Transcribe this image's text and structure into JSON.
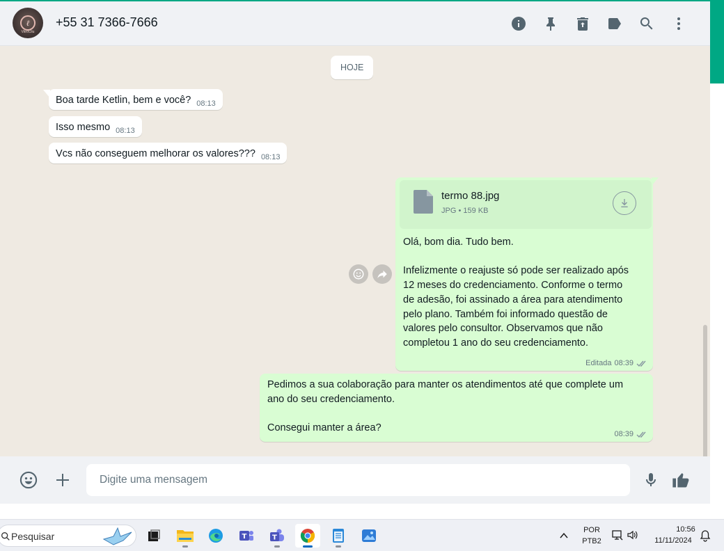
{
  "header": {
    "contact_name": "+55 31 7366-7666",
    "avatar_brand": "VitroCliu",
    "icons": [
      "info-icon",
      "pin-icon",
      "delete-icon",
      "label-icon",
      "search-icon",
      "more-vertical-icon"
    ]
  },
  "chat": {
    "date_chip": "HOJE",
    "incoming": [
      {
        "text": "Boa tarde Ketlin, bem e você?",
        "time": "08:13"
      },
      {
        "text": "Isso mesmo",
        "time": "08:13"
      },
      {
        "text": "Vcs não conseguem melhorar os valores???",
        "time": "08:13"
      }
    ],
    "outgoing_doc": {
      "file_name": "termo 88.jpg",
      "file_meta": "JPG • 159 KB",
      "lines": [
        "Olá, bom dia. Tudo bem.",
        "",
        "Infelizmente o reajuste só pode ser realizado após",
        "12 meses do credenciamento. Conforme o termo",
        "de adesão, foi assinado a área para atendimento",
        "pelo plano. Também foi informado questão de",
        "valores pelo consultor. Observamos que não",
        "completou 1 ano do seu credenciamento."
      ],
      "edited_label": "Editada",
      "time": "08:39"
    },
    "outgoing_text": {
      "lines": [
        "Pedimos a sua colaboração para manter os atendimentos até que complete um",
        "ano do seu credenciamento.",
        "",
        "Consegui manter a área?"
      ],
      "time": "08:39"
    }
  },
  "composer": {
    "placeholder": "Digite uma mensagem"
  },
  "taskbar": {
    "search_label": "Pesquisar",
    "apps": [
      "task-view",
      "file-explorer",
      "edge",
      "teams-classic",
      "teams",
      "chrome",
      "notepad",
      "photos"
    ],
    "language": "POR",
    "keyboard": "PTB2",
    "time": "10:56",
    "date": "11/11/2024"
  },
  "colors": {
    "accent": "#00a884",
    "outgoing_bubble": "#d9fdd3",
    "chat_bg": "#efeae2",
    "tick": "#8696a0"
  }
}
